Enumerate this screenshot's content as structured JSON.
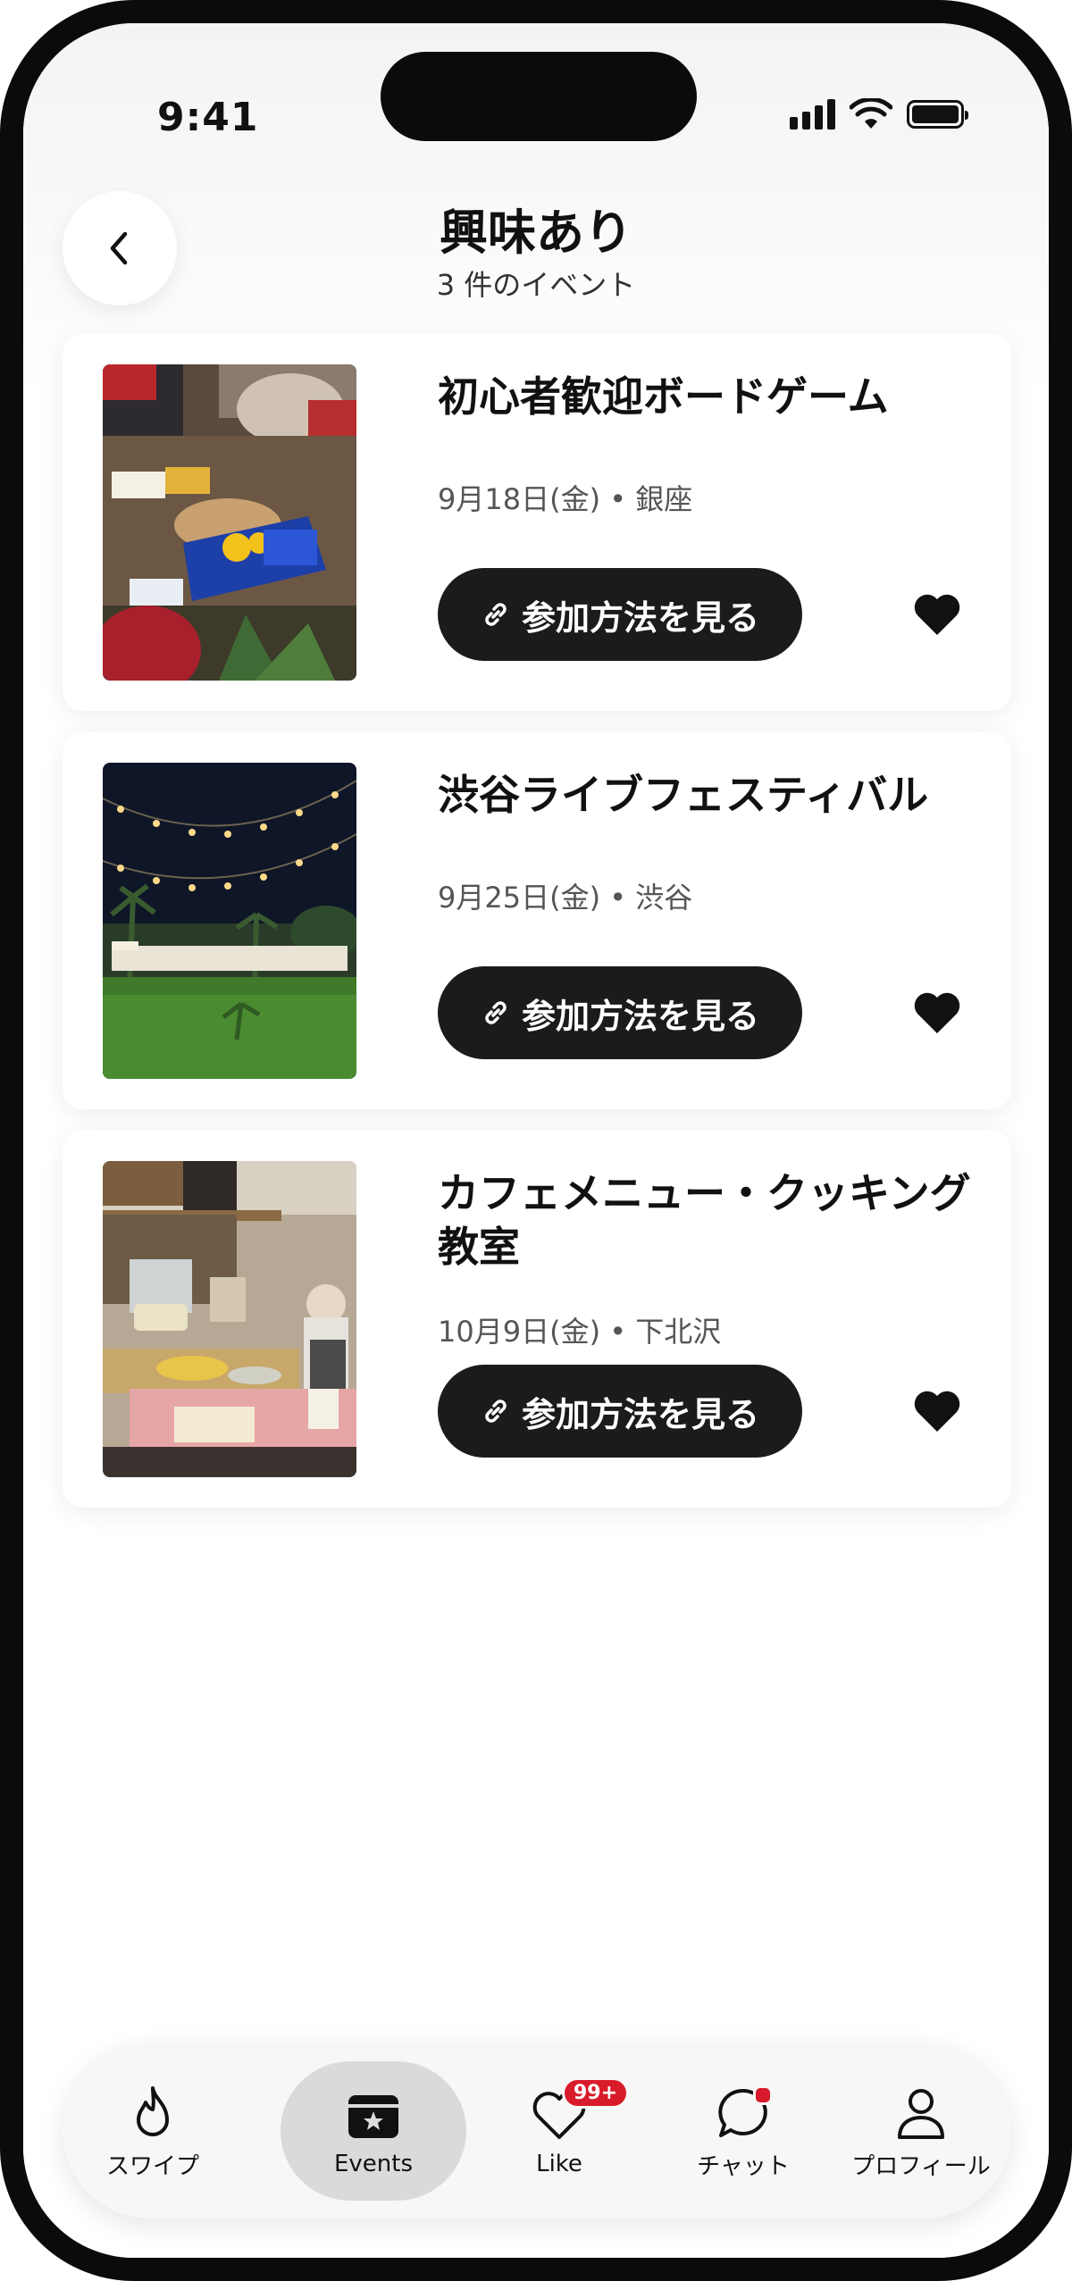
{
  "status_bar": {
    "time": "9:41"
  },
  "header": {
    "title": "興味あり",
    "subtitle": "3 件のイベント"
  },
  "events": [
    {
      "title": "初心者歓迎ボードゲーム",
      "date": "9月18日(金)",
      "separator": "•",
      "place": "銀座",
      "button_label": "参加方法を見る",
      "liked": true
    },
    {
      "title": "渋谷ライブフェスティバル",
      "date": "9月25日(金)",
      "separator": "•",
      "place": "渋谷",
      "button_label": "参加方法を見る",
      "liked": true
    },
    {
      "title": "カフェメニュー・クッキング教室",
      "date": "10月9日(金)",
      "separator": "•",
      "place": "下北沢",
      "button_label": "参加方法を見る",
      "liked": true
    }
  ],
  "tabbar": {
    "active": "Events",
    "items": [
      {
        "label": "スワイプ",
        "icon": "flame-icon"
      },
      {
        "label": "Events",
        "icon": "ticket-star-icon"
      },
      {
        "label": "Like",
        "icon": "heart-outline-icon",
        "badge": "99+"
      },
      {
        "label": "チャット",
        "icon": "chat-bubble-icon"
      },
      {
        "label": "プロフィール",
        "icon": "person-icon"
      }
    ]
  },
  "colors": {
    "accent": "#d81b2b",
    "button_dark": "#1b1b1b",
    "text_primary": "#111111"
  }
}
